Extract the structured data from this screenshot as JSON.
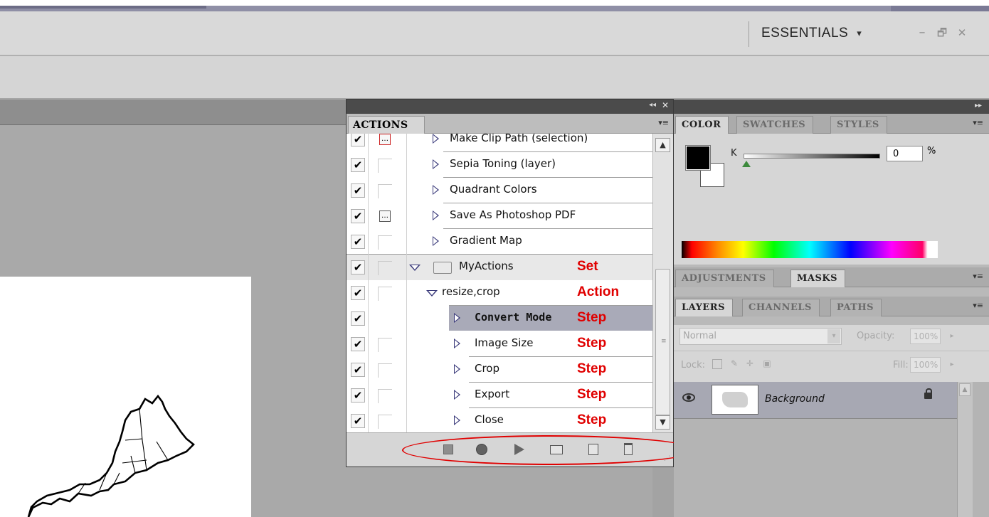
{
  "window": {
    "workspace_label": "ESSENTIALS",
    "workspace_arrow": "▾",
    "minimize": "–",
    "restore": "🗗",
    "close": "✕"
  },
  "actions_panel": {
    "tab": "ACTIONS",
    "menu_icon": "▾≡",
    "collapse_icon": "◂◂",
    "close_icon": "✕",
    "rows": [
      {
        "label": "Make Clip Path (selection)",
        "kind": "action",
        "checked": true,
        "dialog": "red"
      },
      {
        "label": "Sepia Toning (layer)",
        "kind": "action",
        "checked": true,
        "dialog": "none"
      },
      {
        "label": "Quadrant Colors",
        "kind": "action",
        "checked": true,
        "dialog": "none"
      },
      {
        "label": "Save As Photoshop PDF",
        "kind": "action",
        "checked": true,
        "dialog": "box"
      },
      {
        "label": "Gradient Map",
        "kind": "action",
        "checked": true,
        "dialog": "none"
      },
      {
        "label": "MyActions",
        "kind": "set",
        "checked": true,
        "dialog": "none",
        "annotation": "Set"
      },
      {
        "label": "resize,crop",
        "kind": "action-open",
        "checked": true,
        "dialog": "none",
        "annotation": "Action"
      },
      {
        "label": "Convert Mode",
        "kind": "step",
        "checked": true,
        "dialog": "blank",
        "annotation": "Step",
        "selected": true
      },
      {
        "label": "Image Size",
        "kind": "step",
        "checked": true,
        "dialog": "none",
        "annotation": "Step"
      },
      {
        "label": "Crop",
        "kind": "step",
        "checked": true,
        "dialog": "none",
        "annotation": "Step"
      },
      {
        "label": "Export",
        "kind": "step",
        "checked": true,
        "dialog": "none",
        "annotation": "Step"
      },
      {
        "label": "Close",
        "kind": "step",
        "checked": true,
        "dialog": "none",
        "annotation": "Step"
      }
    ],
    "footer_buttons": [
      "stop-playing",
      "begin-recording",
      "play-selection",
      "create-new-set",
      "create-new-action",
      "delete"
    ]
  },
  "color_panel": {
    "tabs": [
      "COLOR",
      "SWATCHES",
      "STYLES"
    ],
    "active_tab": "COLOR",
    "menu_icon": "▾≡",
    "channel_label": "K",
    "value": "0",
    "unit": "%",
    "foreground_color": "#000000",
    "background_color": "#ffffff",
    "slider_level": 0
  },
  "adjustments_panel": {
    "tabs": [
      "ADJUSTMENTS",
      "MASKS"
    ],
    "active_tab": "MASKS",
    "menu_icon": "▾≡"
  },
  "layers_panel": {
    "tabs": [
      "LAYERS",
      "CHANNELS",
      "PATHS"
    ],
    "active_tab": "LAYERS",
    "menu_icon": "▾≡",
    "blend_mode": "Normal",
    "opacity_label": "Opacity:",
    "opacity_value": "100%",
    "lock_label": "Lock:",
    "fill_label": "Fill:",
    "fill_value": "100%",
    "layers": [
      {
        "name": "Background",
        "visible": true,
        "locked": true
      }
    ]
  },
  "colors": {
    "annotation_red": "#e00000",
    "selected_row": "#a9aab8"
  }
}
